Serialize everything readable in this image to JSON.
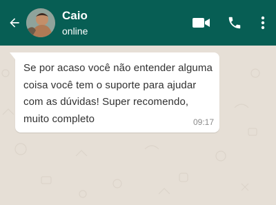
{
  "header": {
    "contact_name": "Caio",
    "contact_status": "online",
    "colors": {
      "bar": "#075e54",
      "text": "#ffffff"
    },
    "icons": [
      "back-arrow-icon",
      "video-call-icon",
      "phone-icon",
      "more-vertical-icon"
    ]
  },
  "chat": {
    "wallpaper_color": "#e6dfd6",
    "messages": [
      {
        "text": "Se por acaso você não entender alguma coisa você tem o suporte para ajudar com as dúvidas! Super recomendo, muito completo",
        "time": "09:17",
        "direction": "incoming"
      }
    ]
  }
}
